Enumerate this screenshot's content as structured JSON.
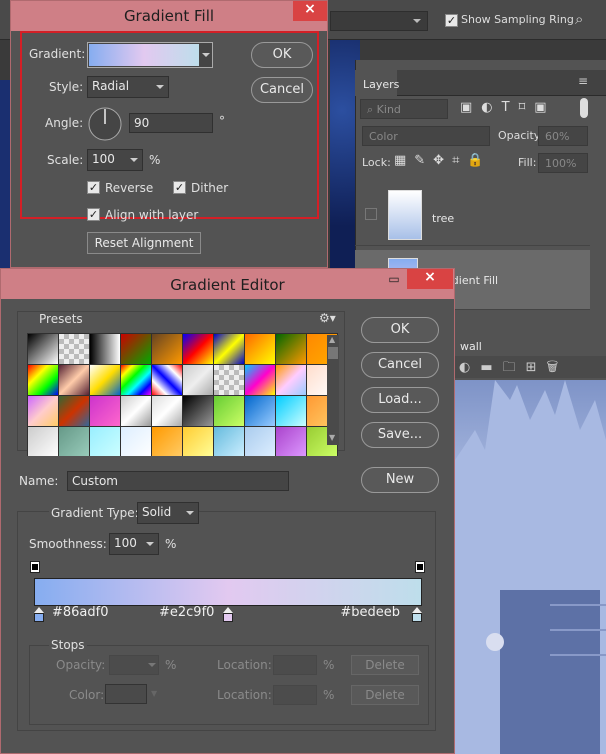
{
  "ps": {
    "show_sampling_ring": "Show Sampling Ring",
    "layers_tab": "Layers",
    "kind": "Kind",
    "blend_mode": "Color",
    "opacity_label": "Opacity:",
    "opacity_value": "60%",
    "lock_label": "Lock:",
    "fill_label": "Fill:",
    "fill_value": "100%",
    "layer_tree": "tree",
    "layer_gradient": "Gradient Fill",
    "layer_wall": "wall"
  },
  "gradient_fill": {
    "title": "Gradient Fill",
    "close": "×",
    "gradient_label": "Gradient:",
    "style_label": "Style:",
    "style_value": "Radial",
    "angle_label": "Angle:",
    "angle_value": "90",
    "angle_unit": "°",
    "scale_label": "Scale:",
    "scale_value": "100",
    "scale_unit": "%",
    "reverse": "Reverse",
    "dither": "Dither",
    "align": "Align with layer",
    "reset": "Reset Alignment",
    "ok": "OK",
    "cancel": "Cancel",
    "angle_deg": 90
  },
  "gradient_editor": {
    "title": "Gradient Editor",
    "minimize": "▭",
    "close": "×",
    "presets": "Presets",
    "ok": "OK",
    "cancel": "Cancel",
    "load": "Load...",
    "save": "Save...",
    "name_label": "Name:",
    "name_value": "Custom",
    "new": "New",
    "type_label": "Gradient Type:",
    "type_value": "Solid",
    "smoothness_label": "Smoothness:",
    "smoothness_value": "100",
    "smoothness_unit": "%",
    "stops_label": "Stops",
    "opacity_label": "Opacity:",
    "opacity_unit": "%",
    "color_label": "Color:",
    "location_label": "Location:",
    "location_unit": "%",
    "delete": "Delete",
    "stop_colors": [
      "#86adf0",
      "#e2c9f0",
      "#bedeeb"
    ],
    "stop_positions": [
      0,
      0.5,
      1
    ]
  },
  "colors": {
    "stop1": "#86adf0",
    "stop2": "#e2c9f0",
    "stop3": "#bedeeb",
    "accent_red": "#d41f26",
    "title_pink": "#cf7f86"
  }
}
